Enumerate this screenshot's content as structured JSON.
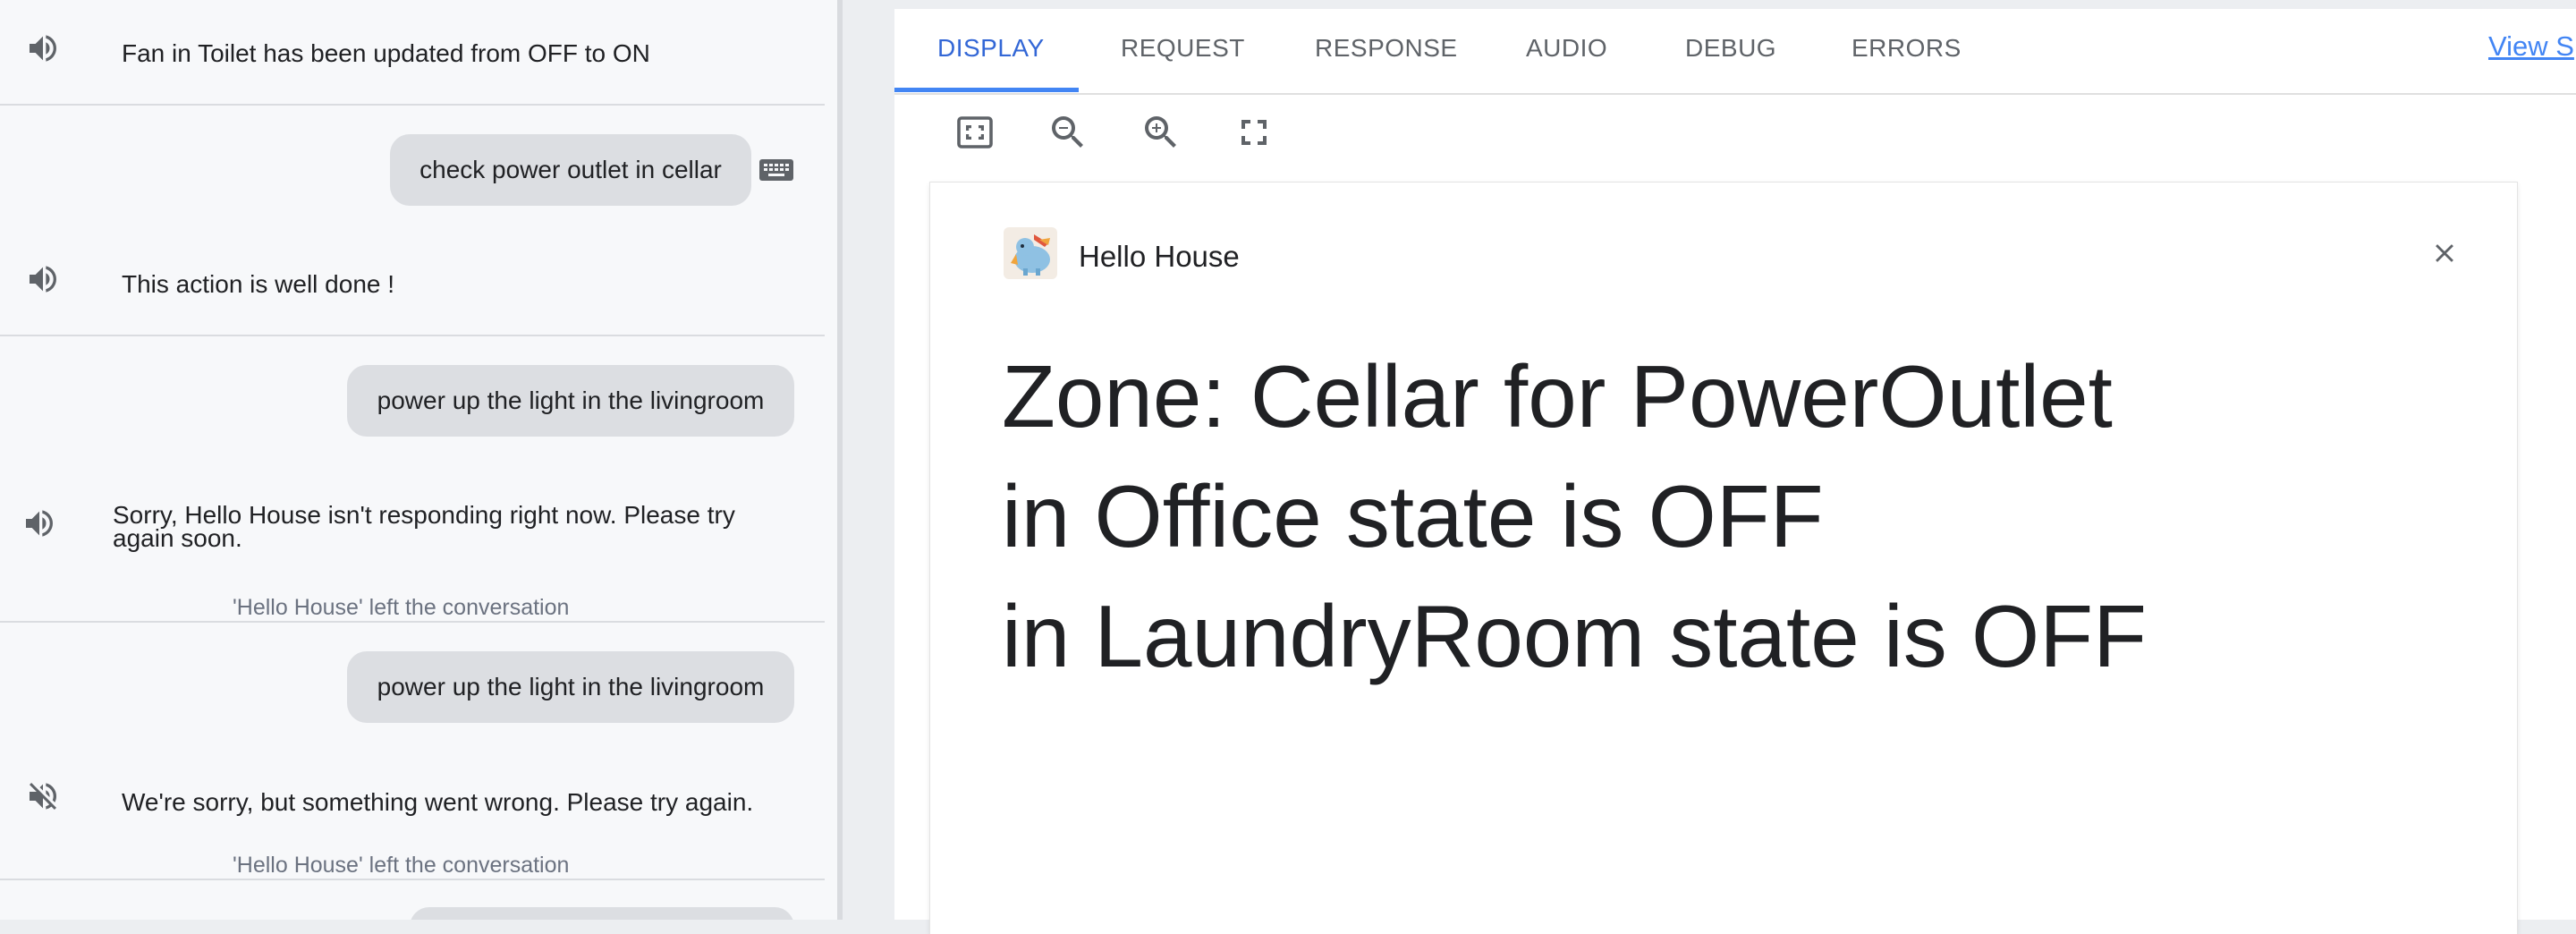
{
  "conversation": {
    "messages": [
      {
        "type": "assistant",
        "text": "Fan in Toilet has been updated from OFF to ON",
        "icon": "speaker-icon"
      },
      {
        "type": "user",
        "text": "check power outlet in cellar",
        "icon": "keyboard-icon"
      },
      {
        "type": "assistant",
        "text": "This action is well done !",
        "icon": "speaker-icon"
      },
      {
        "type": "user",
        "text": "power up the light in the livingroom"
      },
      {
        "type": "assistant",
        "text": "Sorry, Hello House isn't responding right now. Please try again soon.",
        "icon": "speaker-icon"
      },
      {
        "type": "note",
        "text": "'Hello House' left the conversation"
      },
      {
        "type": "user",
        "text": "power up the light in the livingroom"
      },
      {
        "type": "assistant",
        "text": "We're sorry, but something went wrong. Please try again.",
        "icon": "speaker-muted-icon"
      },
      {
        "type": "note",
        "text": "'Hello House' left the conversation"
      }
    ]
  },
  "simulator": {
    "tabs": [
      {
        "label": "DISPLAY",
        "active": true
      },
      {
        "label": "REQUEST",
        "active": false
      },
      {
        "label": "RESPONSE",
        "active": false
      },
      {
        "label": "AUDIO",
        "active": false
      },
      {
        "label": "DEBUG",
        "active": false
      },
      {
        "label": "ERRORS",
        "active": false
      }
    ],
    "view_link": "View S",
    "toolbar": [
      "fit-screen-icon",
      "zoom-out-icon",
      "zoom-in-icon",
      "fullscreen-icon"
    ],
    "card": {
      "app_name": "Hello House",
      "lines": [
        "Zone: Cellar for PowerOutlet",
        "in Office state is OFF",
        "in LaundryRoom state is OFF"
      ]
    }
  },
  "colors": {
    "accent": "#4285f4",
    "active_tab": "#3367d6",
    "bubble": "#dcdee2",
    "panel": "#f7f8fa"
  }
}
